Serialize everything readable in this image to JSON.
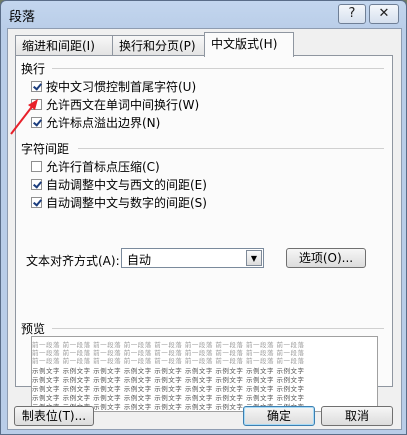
{
  "window": {
    "title": "段落",
    "help_label": "?",
    "close_label": "✕"
  },
  "tabs": [
    {
      "label": "缩进和间距(I)",
      "active": false
    },
    {
      "label": "换行和分页(P)",
      "active": false
    },
    {
      "label": "中文版式(H)",
      "active": true
    }
  ],
  "line_break": {
    "title": "换行",
    "options": [
      {
        "label": "按中文习惯控制首尾字符(U)",
        "checked": true
      },
      {
        "label": "允许西文在单词中间换行(W)",
        "checked": false
      },
      {
        "label": "允许标点溢出边界(N)",
        "checked": true
      }
    ]
  },
  "char_spacing": {
    "title": "字符间距",
    "options": [
      {
        "label": "允许行首标点压缩(C)",
        "checked": false
      },
      {
        "label": "自动调整中文与西文的间距(E)",
        "checked": true
      },
      {
        "label": "自动调整中文与数字的间距(S)",
        "checked": true
      }
    ]
  },
  "text_alignment": {
    "label": "文本对齐方式(A):",
    "selected": "自动",
    "options_button": "选项(O)..."
  },
  "preview": {
    "title": "预览",
    "prev_text": "前一段落 前一段落 前一段落 前一段落 前一段落 前一段落 前一段落 前一段落 前一段落",
    "sample_text": "示例文字 示例文字 示例文字 示例文字 示例文字 示例文字 示例文字 示例文字 示例文字"
  },
  "footer": {
    "tabs_button": "制表位(T)...",
    "ok_button": "确定",
    "cancel_button": "取消"
  },
  "colors": {
    "annotation_arrow": "#e8202a",
    "checkmark": "#1c3e7e"
  }
}
